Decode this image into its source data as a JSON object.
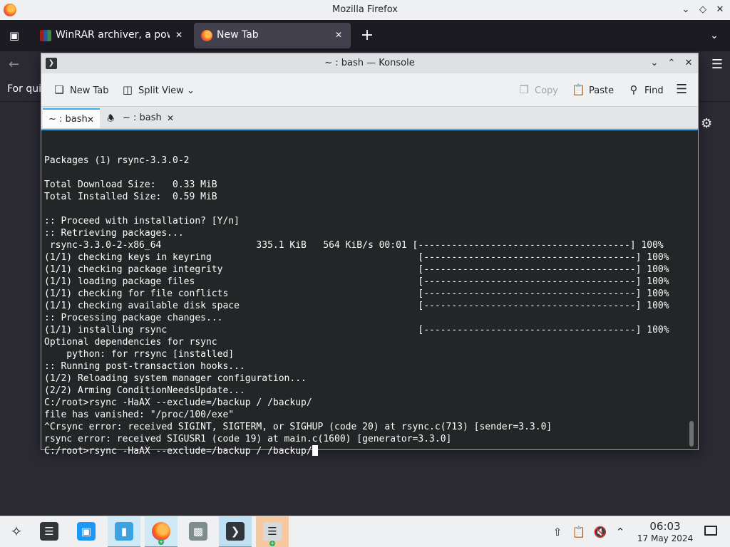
{
  "firefox": {
    "window_title": "Mozilla Firefox",
    "tabs": [
      {
        "label": "WinRAR archiver, a powerful tool",
        "icon": "winrar-icon"
      },
      {
        "label": "New Tab",
        "icon": "firefox-icon"
      }
    ],
    "new_tab_symbol": "+",
    "content_hint": "For qui"
  },
  "konsole": {
    "window_title": "~ : bash — Konsole",
    "toolbar": {
      "new_tab": "New Tab",
      "split_view": "Split View",
      "copy": "Copy",
      "paste": "Paste",
      "find": "Find"
    },
    "tabs": [
      {
        "label": "~ : bash"
      },
      {
        "label": "~ : bash"
      }
    ],
    "terminal_lines": [
      "",
      "Packages (1) rsync-3.3.0-2",
      "",
      "Total Download Size:   0.33 MiB",
      "Total Installed Size:  0.59 MiB",
      "",
      ":: Proceed with installation? [Y/n]",
      ":: Retrieving packages...",
      " rsync-3.3.0-2-x86_64                 335.1 KiB   564 KiB/s 00:01 [--------------------------------------] 100%",
      "(1/1) checking keys in keyring                                     [--------------------------------------] 100%",
      "(1/1) checking package integrity                                   [--------------------------------------] 100%",
      "(1/1) loading package files                                        [--------------------------------------] 100%",
      "(1/1) checking for file conflicts                                  [--------------------------------------] 100%",
      "(1/1) checking available disk space                                [--------------------------------------] 100%",
      ":: Processing package changes...",
      "(1/1) installing rsync                                             [--------------------------------------] 100%",
      "Optional dependencies for rsync",
      "    python: for rrsync [installed]",
      ":: Running post-transaction hooks...",
      "(1/2) Reloading system manager configuration...",
      "(2/2) Arming ConditionNeedsUpdate...",
      "C:/root>rsync -HaAX --exclude=/backup / /backup/",
      "file has vanished: \"/proc/100/exe\"",
      "^Crsync error: received SIGINT, SIGTERM, or SIGHUP (code 20) at rsync.c(713) [sender=3.3.0]",
      "rsync error: received SIGUSR1 (code 19) at main.c(1600) [generator=3.3.0]"
    ],
    "prompt_line": "C:/root>rsync -HaAX --exclude=/backup / /backup/"
  },
  "taskbar": {
    "apps": [
      {
        "name": "application-launcher"
      },
      {
        "name": "system-settings"
      },
      {
        "name": "discover"
      },
      {
        "name": "dolphin-file-manager"
      },
      {
        "name": "firefox"
      },
      {
        "name": "disk-utility"
      },
      {
        "name": "konsole"
      },
      {
        "name": "archive-manager"
      }
    ],
    "clock_time": "06:03",
    "clock_date": "17 May 2024"
  },
  "colors": {
    "accent": "#3daee9",
    "terminal_bg": "#232627",
    "terminal_fg": "#fcfcfc",
    "firefox_dark": "#1c1b22"
  }
}
